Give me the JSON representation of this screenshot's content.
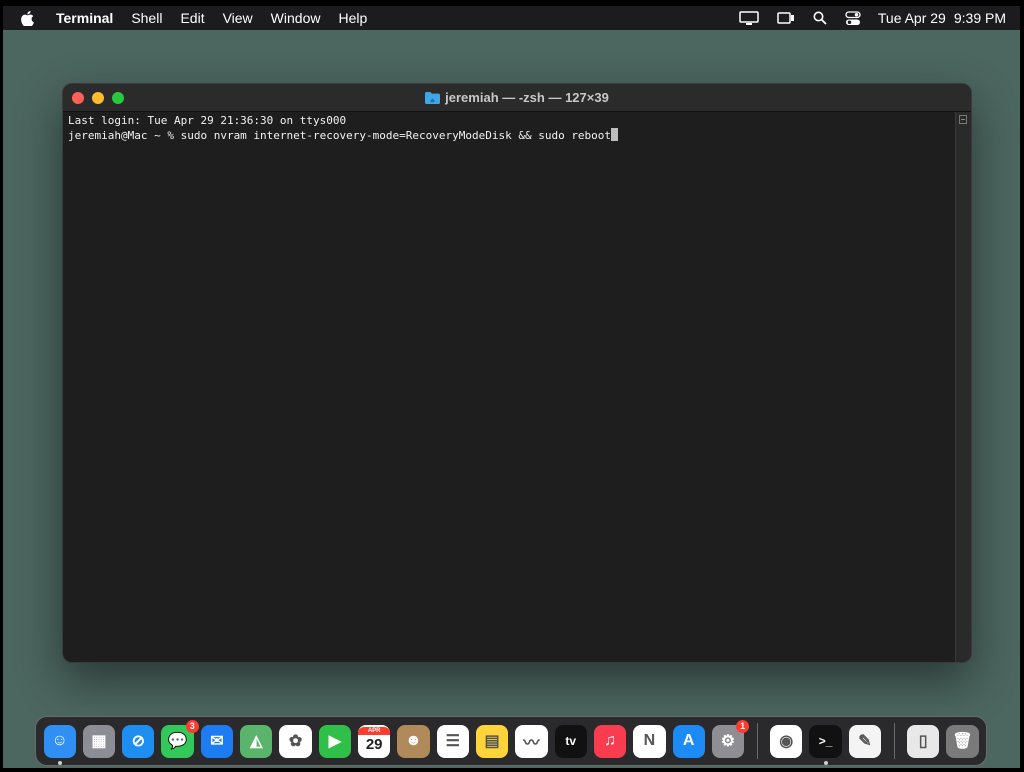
{
  "menubar": {
    "app_name": "Terminal",
    "menus": [
      "Shell",
      "Edit",
      "View",
      "Window",
      "Help"
    ],
    "status_icons": [
      "display-icon",
      "screen-mirroring-icon",
      "search-icon",
      "control-center-icon"
    ],
    "date": "Tue Apr 29",
    "time": "9:39 PM"
  },
  "window": {
    "title": "jeremiah — -zsh — 127×39",
    "lines": [
      "Last login: Tue Apr 29 21:36:30 on ttys000",
      "jeremiah@Mac ~ % sudo nvram internet-recovery-mode=RecoveryModeDisk && sudo reboot"
    ]
  },
  "dock": {
    "apps": [
      {
        "name": "Finder",
        "icon": "finder-icon",
        "color": "#2f8ff5",
        "glyph": "☺",
        "running": true
      },
      {
        "name": "Launchpad",
        "icon": "launchpad-icon",
        "color": "#8d8d95",
        "glyph": "▦"
      },
      {
        "name": "Safari",
        "icon": "safari-icon",
        "color": "#1e8ef0",
        "glyph": "⊘"
      },
      {
        "name": "Messages",
        "icon": "messages-icon",
        "color": "#34c759",
        "glyph": "💬",
        "badge": "3"
      },
      {
        "name": "Mail",
        "icon": "mail-icon",
        "color": "#1e7cf2",
        "glyph": "✉"
      },
      {
        "name": "Maps",
        "icon": "maps-icon",
        "color": "#5ab46b",
        "glyph": "◭"
      },
      {
        "name": "Photos",
        "icon": "photos-icon",
        "color": "#ffffff",
        "glyph": "✿"
      },
      {
        "name": "FaceTime",
        "icon": "facetime-icon",
        "color": "#30c04a",
        "glyph": "▶"
      },
      {
        "name": "Calendar",
        "icon": "calendar-icon",
        "color": "#ffffff",
        "glyph": "29",
        "label": "APR"
      },
      {
        "name": "Contacts",
        "icon": "contacts-icon",
        "color": "#b08a5a",
        "glyph": "☻"
      },
      {
        "name": "Reminders",
        "icon": "reminders-icon",
        "color": "#ffffff",
        "glyph": "☰"
      },
      {
        "name": "Notes",
        "icon": "notes-icon",
        "color": "#ffd43b",
        "glyph": "▤"
      },
      {
        "name": "Freeform",
        "icon": "freeform-icon",
        "color": "#ffffff",
        "glyph": "〰"
      },
      {
        "name": "TV",
        "icon": "tv-icon",
        "color": "#111111",
        "glyph": "tv"
      },
      {
        "name": "Music",
        "icon": "music-icon",
        "color": "#fa3c50",
        "glyph": "♫"
      },
      {
        "name": "News",
        "icon": "news-icon",
        "color": "#ffffff",
        "glyph": "N"
      },
      {
        "name": "App Store",
        "icon": "app-store-icon",
        "color": "#1c8bf5",
        "glyph": "A"
      },
      {
        "name": "System Settings",
        "icon": "system-settings-icon",
        "color": "#8e8e93",
        "glyph": "⚙",
        "badge": "1"
      },
      {
        "sep": true
      },
      {
        "name": "Chrome",
        "icon": "chrome-icon",
        "color": "#ffffff",
        "glyph": "◉"
      },
      {
        "name": "Terminal",
        "icon": "terminal-icon",
        "color": "#111111",
        "glyph": ">_",
        "running": true
      },
      {
        "name": "TextEdit",
        "icon": "textedit-icon",
        "color": "#f4f4f4",
        "glyph": "✎"
      },
      {
        "sep": true
      },
      {
        "name": "Document",
        "icon": "document-icon",
        "color": "#e8e8e8",
        "glyph": "▯"
      },
      {
        "name": "Trash",
        "icon": "trash-icon",
        "color": "#7a7a7a",
        "glyph": "🗑"
      }
    ]
  }
}
